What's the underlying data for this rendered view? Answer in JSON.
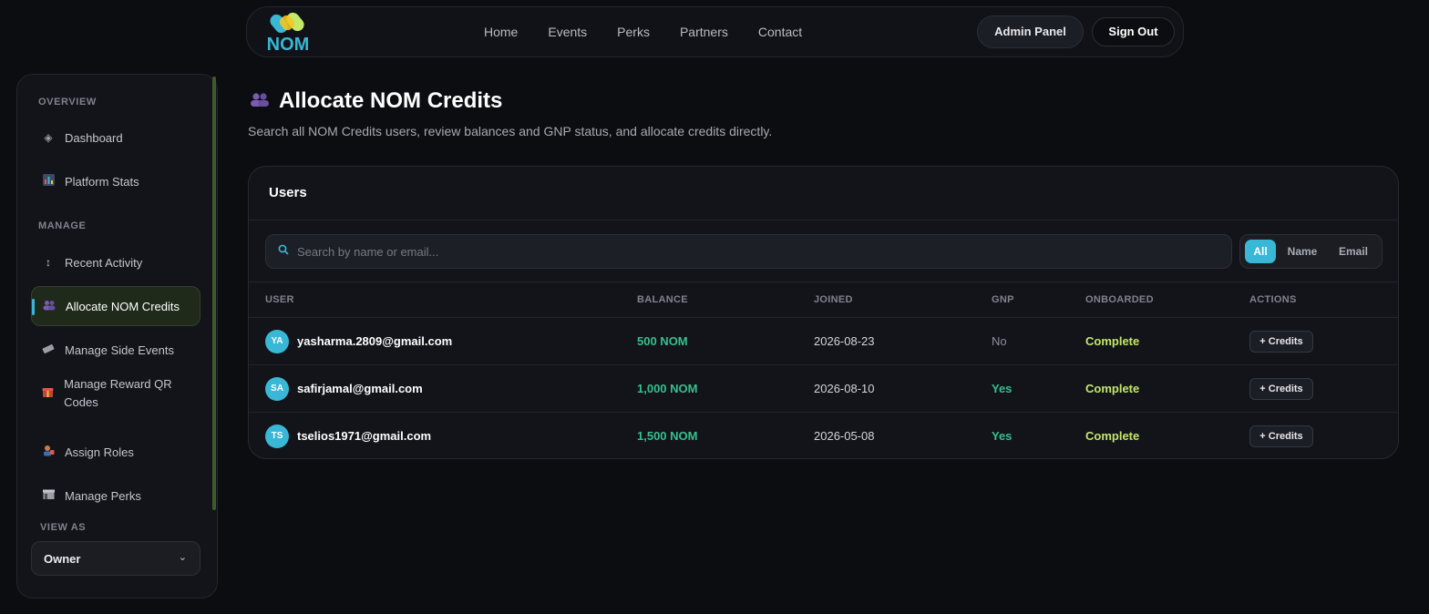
{
  "header": {
    "logo_text": "NOM",
    "nav": [
      "Home",
      "Events",
      "Perks",
      "Partners",
      "Contact"
    ],
    "admin_label": "Admin Panel",
    "signout_label": "Sign Out"
  },
  "sidebar": {
    "section_overview": "OVERVIEW",
    "section_manage": "MANAGE",
    "section_viewas": "VIEW AS",
    "items": [
      {
        "label": "Dashboard",
        "icon": "diamond-icon"
      },
      {
        "label": "Platform Stats",
        "icon": "bar-chart-icon"
      },
      {
        "label": "Recent Activity",
        "icon": "up-down-arrow-icon"
      },
      {
        "label": "Allocate NOM Credits",
        "icon": "users-icon",
        "active": true
      },
      {
        "label": "Manage Side Events",
        "icon": "ticket-icon"
      },
      {
        "label": "Manage Reward QR Codes",
        "icon": "gift-icon"
      },
      {
        "label": "Assign Roles",
        "icon": "person-tag-icon"
      },
      {
        "label": "Manage Perks",
        "icon": "store-icon"
      }
    ],
    "view_as_value": "Owner"
  },
  "page": {
    "title": "Allocate NOM Credits",
    "subtitle": "Search all NOM Credits users, review balances and GNP status, and allocate credits directly."
  },
  "users_card": {
    "title": "Users",
    "search_placeholder": "Search by name or email...",
    "filters": [
      "All",
      "Name",
      "Email"
    ],
    "active_filter": "All",
    "columns": [
      "USER",
      "BALANCE",
      "JOINED",
      "GNP",
      "ONBOARDED",
      "ACTIONS"
    ],
    "rows": [
      {
        "initials": "YA",
        "email": "yasharma.2809@gmail.com",
        "balance": "500 NOM",
        "joined": "2026-08-23",
        "gnp": "No",
        "onboarded": "Complete",
        "action": "+ Credits"
      },
      {
        "initials": "SA",
        "email": "safirjamal@gmail.com",
        "balance": "1,000 NOM",
        "joined": "2026-08-10",
        "gnp": "Yes",
        "onboarded": "Complete",
        "action": "+ Credits"
      },
      {
        "initials": "TS",
        "email": "tselios1971@gmail.com",
        "balance": "1,500 NOM",
        "joined": "2026-05-08",
        "gnp": "Yes",
        "onboarded": "Complete",
        "action": "+ Credits"
      }
    ]
  },
  "colors": {
    "accent": "#38b7d6",
    "balance_green": "#33c08c",
    "onboarded_lime": "#c3e86a",
    "background": "#0c0d11"
  }
}
